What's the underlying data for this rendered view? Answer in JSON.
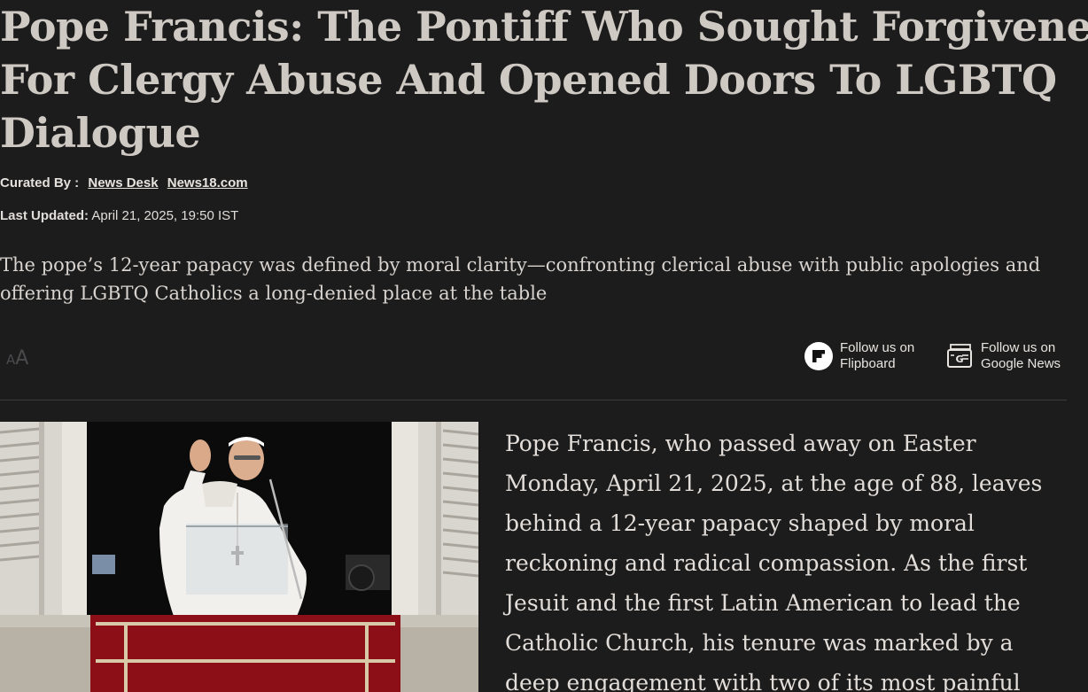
{
  "article": {
    "headline_lines": [
      "Pope Francis: The Pontiff Who Sought Forgiveness",
      "For Clergy Abuse And Opened Doors To LGBTQ",
      "Dialogue"
    ],
    "byline": {
      "curated_label": "Curated By :",
      "authors": [
        "News Desk",
        "News18.com"
      ]
    },
    "last_updated": {
      "label": "Last Updated:",
      "value": "April 21, 2025, 19:50 IST"
    },
    "summary_lines": [
      "The pope’s 12-year papacy was defined by moral clarity—confronting clerical abuse with public apologies and",
      "offering LGBTQ Catholics a long-denied place at the table"
    ],
    "body_lines": [
      "Pope Francis, who passed away on Easter",
      "Monday, April 21, 2025, at the age of 88, leaves",
      "behind a 12-year papacy shaped by moral",
      "reckoning and radical compassion. As the first",
      "Jesuit and the first Latin American to lead the",
      "Catholic Church, his tenure was marked by a",
      "deep engagement with two of its most painful"
    ]
  },
  "toolbar": {
    "font_size_label": "AA",
    "follow_flipboard": [
      "Follow us on",
      "Flipboard"
    ],
    "follow_google_news": [
      "Follow us on",
      "Google News"
    ]
  },
  "colors": {
    "background": "#1c1c1d",
    "headline": "#cfc9c3",
    "balcony_drape": "#8c0f17"
  },
  "icons": {
    "flipboard": "flipboard-icon",
    "google_news": "google-news-icon",
    "font_size": "font-size-icon"
  }
}
